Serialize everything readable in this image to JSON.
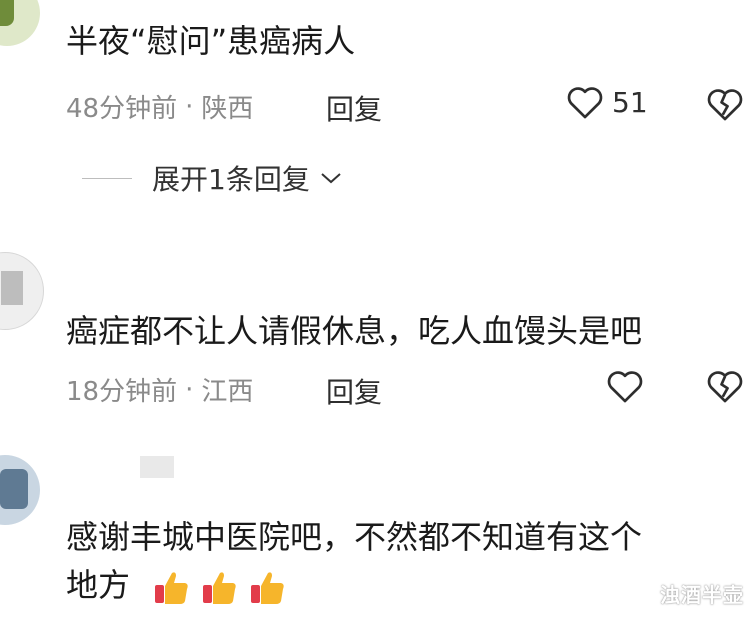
{
  "comments": [
    {
      "text": "半夜“慰问”患癌病人",
      "time": "48分钟前",
      "location": "陕西",
      "reply_label": "回复",
      "likes": "51"
    },
    {
      "text": "癌症都不让人请假休息，吃人血馒头是吧",
      "time": "18分钟前",
      "location": "江西",
      "reply_label": "回复"
    },
    {
      "text_line1": "感谢丰城中医院吧，不然都不知道有这个",
      "text_line2": "地方"
    }
  ],
  "expand_replies": "展开1条回复",
  "separator": "·",
  "watermark": "浊酒半壶",
  "icons": {
    "like": "heart-outline-icon",
    "dislike": "broken-heart-icon",
    "expand": "chevron-down-icon",
    "emoji": "thumbs-up-emoji"
  }
}
